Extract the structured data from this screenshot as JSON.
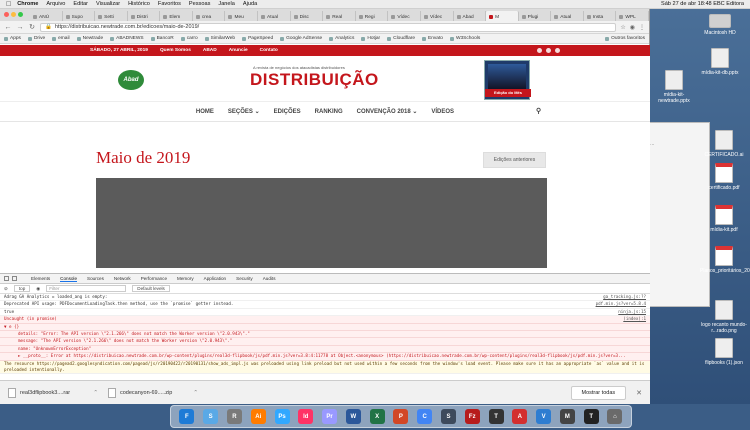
{
  "menubar": {
    "app": "Chrome",
    "items": [
      "Arquivo",
      "Editar",
      "Visualizar",
      "Histórico",
      "Favoritos",
      "Pessoas",
      "Janela",
      "Ajuda"
    ],
    "status": "Sáb 27 de abr  18:48   EBC Editora"
  },
  "tabs": [
    {
      "label": "ANÚ",
      "active": false
    },
    {
      "label": "Supo",
      "active": false
    },
    {
      "label": "Setti",
      "active": false
    },
    {
      "label": "Distri",
      "active": false
    },
    {
      "label": "Elem",
      "active": false
    },
    {
      "label": "crea",
      "active": false
    },
    {
      "label": "Meu",
      "active": false
    },
    {
      "label": "Atual",
      "active": false
    },
    {
      "label": "Disc",
      "active": false
    },
    {
      "label": "Real",
      "active": false
    },
    {
      "label": "Regi",
      "active": false
    },
    {
      "label": "Vídec",
      "active": false
    },
    {
      "label": "Vídec",
      "active": false
    },
    {
      "label": "Abad",
      "active": false
    },
    {
      "label": "M",
      "active": true
    },
    {
      "label": "Plugi",
      "active": false
    },
    {
      "label": "Atual",
      "active": false
    },
    {
      "label": "Insta",
      "active": false
    },
    {
      "label": "WPL",
      "active": false
    }
  ],
  "url": "https://distribuicao.newtrade.com.br/edicoes/maio-de-2019/",
  "bookmarks": [
    "Apps",
    "Drive",
    "email",
    "Newtrade",
    "ABADNEWS",
    "BancoR",
    "carro",
    "SimilarWeb",
    "PageSpeed",
    "Google AdSense",
    "Analytics",
    "Hotjar",
    "Cloudflare",
    "Envato",
    "W3Schools"
  ],
  "bookmarks_other": "Outros favoritos",
  "site": {
    "topbar": {
      "date": "SÁBADO, 27 ABRIL, 2019",
      "items": [
        "Quem Somos",
        "ABAD",
        "Anuncie",
        "Contato"
      ]
    },
    "abad_logo": "Abad",
    "tagline": "A revista de negócios dos atacadistas distribuidores",
    "logo": "DISTRIBUIÇÃO",
    "mag_ribbon": "Edição do Mês",
    "nav": [
      "HOME",
      "SEÇÕES",
      "EDIÇÕES",
      "RANKING",
      "CONVENÇÃO 2018",
      "VÍDEOS"
    ],
    "page_title": "Maio de 2019",
    "prev_button": "Edições anteriores"
  },
  "devtools": {
    "tabs": [
      "Elements",
      "Console",
      "Sources",
      "Network",
      "Performance",
      "Memory",
      "Application",
      "Security",
      "Audits"
    ],
    "active_tab": "Console",
    "context": "top",
    "filter_placeholder": "Filter",
    "levels": "Default levels",
    "logs": [
      {
        "text": "Adrag GA Analytics = loaded_ang is empty:",
        "src": "ga_tracking.js:??",
        "kind": "normal"
      },
      {
        "text": "Deprecated API usage: PDFDocumentLoadingTask.then method, use the `promise` getter instead.",
        "src": "pdf.min.js?ver=5.8.4",
        "kind": "normal"
      },
      {
        "text": "true",
        "src": "ninja.js:15",
        "kind": "normal"
      },
      {
        "text": "Uncaught (in promise)",
        "src": "(index):1",
        "kind": "err"
      },
      {
        "text": "▼ e {}",
        "src": "",
        "kind": "err"
      },
      {
        "text": "details: \"Error: The API version \\\"2.1.266\\\" does not match the Worker version \\\"2.0.943\\\".\"",
        "src": "",
        "kind": "err-indent"
      },
      {
        "text": "message: \"The API version \\\"2.1.266\\\" does not match the Worker version \\\"2.0.943\\\".\"",
        "src": "",
        "kind": "err-indent"
      },
      {
        "text": "name: \"UnknownErrorException\"",
        "src": "",
        "kind": "err-indent"
      },
      {
        "text": "► __proto__: Error at https://distribuicao.newtrade.com.br/wp-content/plugins/real3d-flipbook/js/pdf.min.js?ver=3.8:4:11778 at Object.<anonymous> (https://distribuicao.newtrade.com.br/wp-content/plugins/real3d-flipbook/js/pdf.min.js?ver=3...",
        "src": "",
        "kind": "err-indent"
      },
      {
        "text": "The resource https://pagead2.googlesyndication.com/pagead/js/r20190422/r20190131/show_ads_impl.js was preloaded using link preload but not used within a few seconds from the window's load event. Please make sure it has an appropriate `as` value and it is preloaded intentionally.",
        "src": "",
        "kind": "warn"
      }
    ]
  },
  "downloads": [
    "real3dflipbook3....rar",
    "codecanyon-69.....zip"
  ],
  "show_all": "Mostrar todas",
  "desktop_icons": [
    {
      "label": "Macintosh HD",
      "kind": "drive"
    },
    {
      "label": "mídia-kit-db.pptx",
      "kind": "file"
    },
    {
      "label": "mídia-kit-newtrade.pptx",
      "kind": "file"
    },
    {
      "label": "CERTIFICADO.ai",
      "kind": "file"
    },
    {
      "label": "certificado.pdf",
      "kind": "pdf"
    },
    {
      "label": "mídia-kit.pdf",
      "kind": "pdf"
    },
    {
      "label": "Planos_prioritários_2019.pdf",
      "kind": "pdf"
    },
    {
      "label": "logo recanto mundo-r...rado.png",
      "kind": "file"
    },
    {
      "label": "flipbooks (1).json",
      "kind": "file"
    }
  ],
  "dock_apps": [
    {
      "label": "F",
      "color": "#1e7bd6"
    },
    {
      "label": "S",
      "color": "#5aa9e6"
    },
    {
      "label": "R",
      "color": "#7a7a7a"
    },
    {
      "label": "Ai",
      "color": "#ff7c00"
    },
    {
      "label": "Ps",
      "color": "#31a8ff"
    },
    {
      "label": "Id",
      "color": "#ff3366"
    },
    {
      "label": "Pr",
      "color": "#9999ff"
    },
    {
      "label": "W",
      "color": "#2b579a"
    },
    {
      "label": "X",
      "color": "#217346"
    },
    {
      "label": "P",
      "color": "#d24726"
    },
    {
      "label": "C",
      "color": "#4285f4"
    },
    {
      "label": "S",
      "color": "#3d4a5c"
    },
    {
      "label": "Fz",
      "color": "#b71c1c"
    },
    {
      "label": "T",
      "color": "#333333"
    },
    {
      "label": "A",
      "color": "#d32f2f"
    },
    {
      "label": "V",
      "color": "#2e7dd1"
    },
    {
      "label": "M",
      "color": "#444444"
    },
    {
      "label": "T",
      "color": "#222222"
    },
    {
      "label": "⌂",
      "color": "#6a6a6a"
    }
  ]
}
